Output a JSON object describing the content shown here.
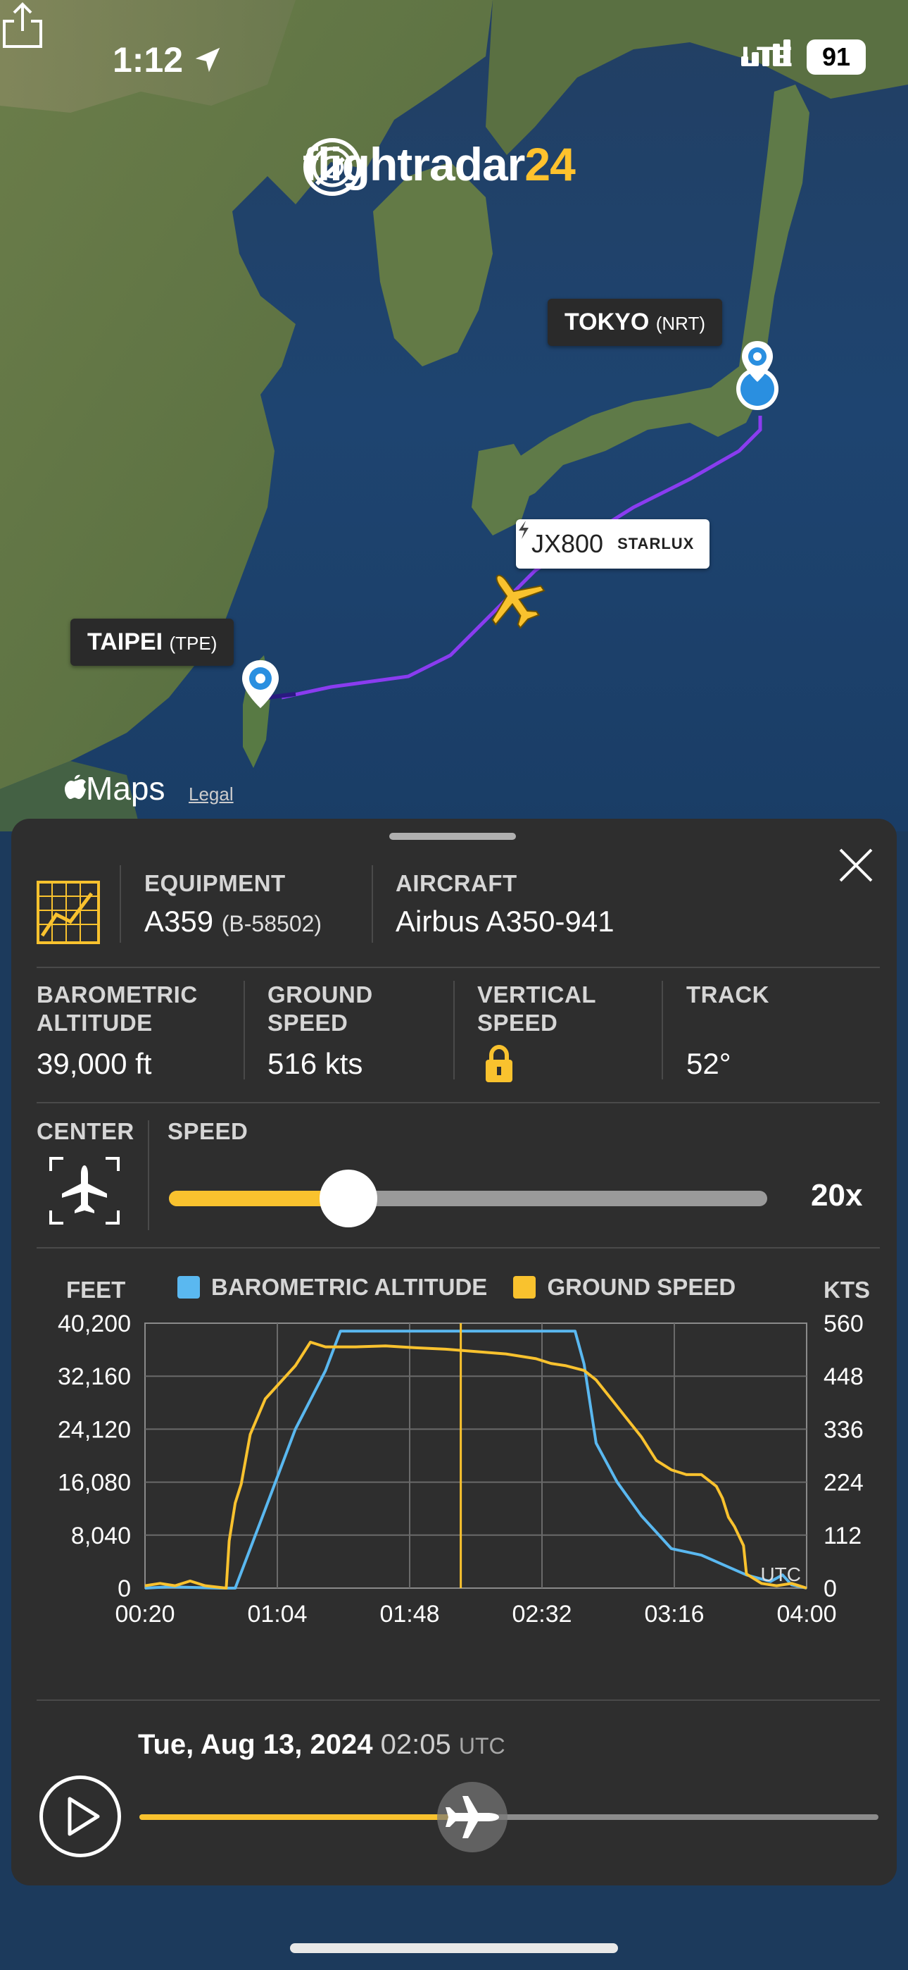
{
  "status_bar": {
    "time": "1:12",
    "network": "LTE",
    "battery": "91"
  },
  "map": {
    "logo_text": "flightradar",
    "logo_num": "24",
    "origin": {
      "city": "TAIPEI",
      "code": "(TPE)"
    },
    "destination": {
      "city": "TOKYO",
      "code": "(NRT)"
    },
    "flight": {
      "callsign": "JX800",
      "airline": "STARLUX"
    },
    "attribution": "Maps",
    "legal": "Legal"
  },
  "details": {
    "equipment_label": "EQUIPMENT",
    "equipment_value": "A359",
    "registration": "(B-58502)",
    "aircraft_label": "AIRCRAFT",
    "aircraft_value": "Airbus A350-941",
    "baro_label_1": "BAROMETRIC",
    "baro_label_2": "ALTITUDE",
    "baro_value": "39,000 ft",
    "gs_label_1": "GROUND",
    "gs_label_2": "SPEED",
    "gs_value": "516 kts",
    "vs_label_1": "VERTICAL",
    "vs_label_2": "SPEED",
    "track_label": "TRACK",
    "track_value": "52°"
  },
  "controls": {
    "center_label": "CENTER",
    "speed_label": "SPEED",
    "speed_value": "20x",
    "speed_fraction": 0.3
  },
  "chart_data": {
    "type": "line",
    "left_axis_label": "FEET",
    "right_axis_label": "KTS",
    "x_ticks": [
      "00:20",
      "01:04",
      "01:48",
      "02:32",
      "03:16",
      "04:00"
    ],
    "y_left_ticks": [
      "40,200",
      "32,160",
      "24,120",
      "16,080",
      "8,040",
      "0"
    ],
    "y_right_ticks": [
      "560",
      "448",
      "336",
      "224",
      "112",
      "0"
    ],
    "ylim_left": [
      0,
      40200
    ],
    "ylim_right": [
      0,
      560
    ],
    "xlim_min": [
      20,
      240
    ],
    "utc_label": "UTC",
    "cursor_min": 125,
    "series": [
      {
        "name": "BAROMETRIC ALTITUDE",
        "color": "#5ab8f0",
        "axis": "left",
        "x": [
          20,
          28,
          45,
          50,
          60,
          70,
          80,
          85,
          137,
          163,
          166,
          170,
          177,
          185,
          195,
          205,
          210,
          220,
          228,
          232,
          235,
          240
        ],
        "y": [
          0,
          200,
          0,
          0,
          12000,
          24120,
          33000,
          39000,
          39000,
          39000,
          34000,
          22000,
          16080,
          11000,
          6000,
          5000,
          4000,
          2000,
          1000,
          2000,
          500,
          0
        ]
      },
      {
        "name": "GROUND SPEED",
        "color": "#f9c22e",
        "axis": "right",
        "x": [
          20,
          25,
          30,
          35,
          40,
          47,
          48,
          50,
          52,
          55,
          60,
          70,
          75,
          80,
          90,
          100,
          110,
          120,
          130,
          140,
          150,
          155,
          160,
          166,
          170,
          175,
          180,
          185,
          190,
          195,
          200,
          205,
          210,
          212,
          214,
          216,
          219,
          220,
          225,
          230,
          235,
          240
        ],
        "y": [
          5,
          10,
          5,
          15,
          5,
          0,
          100,
          180,
          220,
          325,
          400,
          470,
          520,
          510,
          510,
          512,
          508,
          505,
          500,
          495,
          485,
          475,
          470,
          460,
          440,
          400,
          360,
          320,
          270,
          250,
          240,
          240,
          215,
          190,
          150,
          130,
          90,
          30,
          10,
          5,
          10,
          0
        ]
      }
    ]
  },
  "timeline": {
    "date": "Tue, Aug 13, 2024",
    "time": "02:05",
    "tz": "UTC",
    "progress_fraction": 0.45
  }
}
